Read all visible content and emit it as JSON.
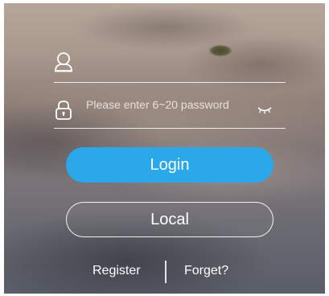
{
  "login": {
    "password_placeholder": "Please enter 6~20 password",
    "login_button": "Login",
    "local_button": "Local",
    "register_link": "Register",
    "forget_link": "Forget?"
  },
  "icons": {
    "username": "user-icon",
    "password": "lock-icon",
    "toggle_visibility": "eye-closed-icon"
  },
  "colors": {
    "login_button": "#2aa8ea"
  }
}
